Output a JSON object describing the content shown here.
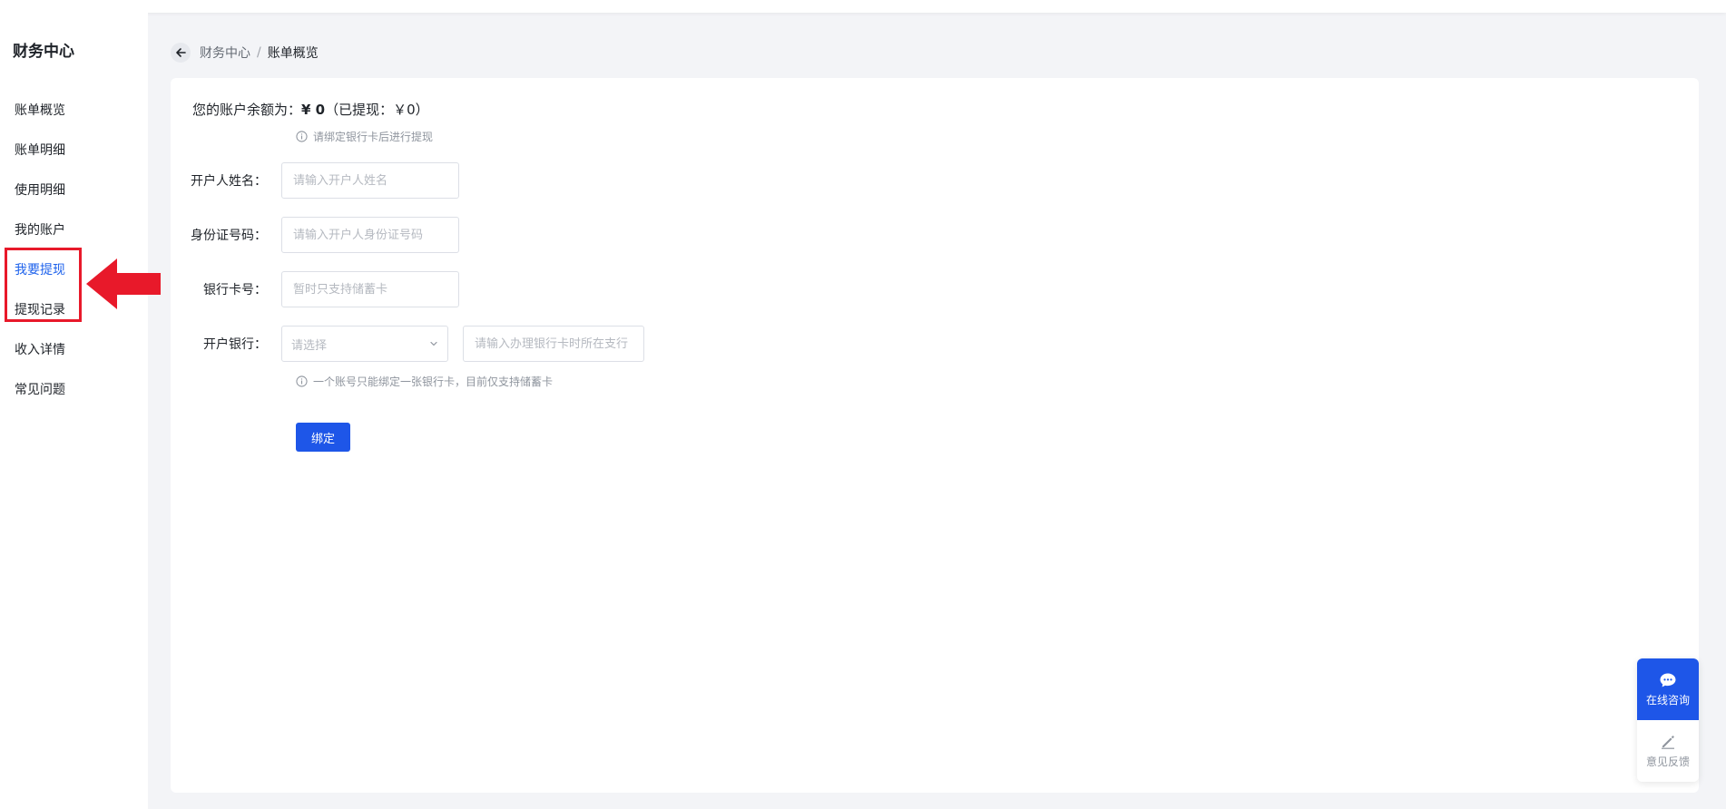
{
  "sidebar": {
    "title": "财务中心",
    "items": [
      {
        "label": "账单概览"
      },
      {
        "label": "账单明细"
      },
      {
        "label": "使用明细"
      },
      {
        "label": "我的账户"
      },
      {
        "label": "我要提现"
      },
      {
        "label": "提现记录"
      },
      {
        "label": "收入详情"
      },
      {
        "label": "常见问题"
      }
    ],
    "active_item": "我要提现"
  },
  "breadcrumb": {
    "parent": "财务中心",
    "separator": "/",
    "current": "账单概览"
  },
  "balance": {
    "prefix": "您的账户余额为：",
    "amount": "¥ 0",
    "withdrawn": "（已提现：￥0）"
  },
  "hints": {
    "bind_card": "请绑定银行卡后进行提现",
    "one_card": "一个账号只能绑定一张银行卡，目前仅支持储蓄卡"
  },
  "form": {
    "holder_name": {
      "label": "开户人姓名：",
      "placeholder": "请输入开户人姓名"
    },
    "id_number": {
      "label": "身份证号码：",
      "placeholder": "请输入开户人身份证号码"
    },
    "card_number": {
      "label": "银行卡号：",
      "placeholder": "暂时只支持储蓄卡"
    },
    "bank": {
      "label": "开户银行：",
      "select_placeholder": "请选择",
      "branch_placeholder": "请输入办理银行卡时所在支行"
    },
    "submit_label": "绑定"
  },
  "float_panel": {
    "consult_label": "在线咨询",
    "feedback_label": "意见反馈"
  },
  "colors": {
    "accent": "#1e56e8",
    "annotation": "#e8192a",
    "active_menu": "#1e62ec"
  }
}
